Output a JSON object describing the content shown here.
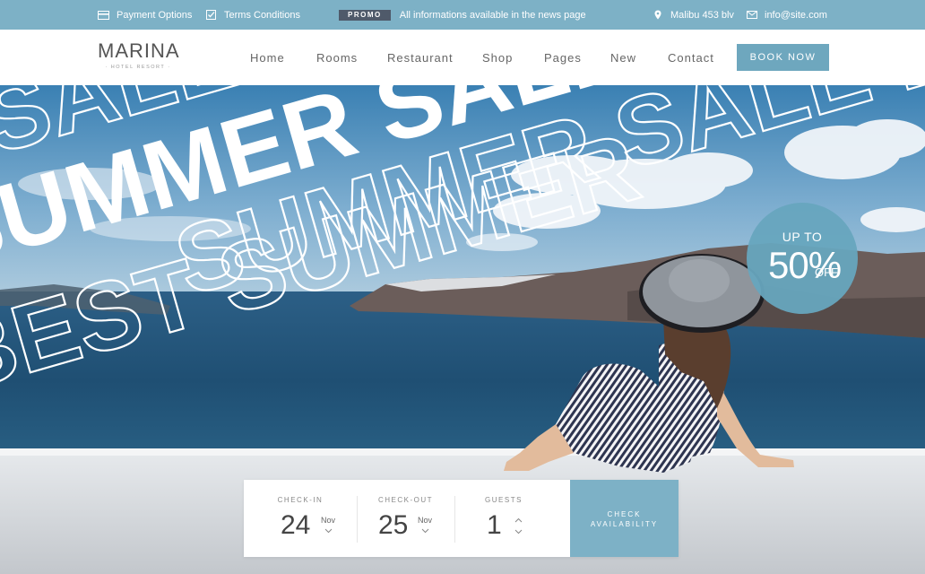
{
  "topbar": {
    "payment_label": "Payment Options",
    "terms_label": "Terms Conditions",
    "promo_badge": "PROMO",
    "promo_text": "All informations available in the news page",
    "address": "Malibu 453 blv",
    "email": "info@site.com"
  },
  "brand": {
    "name": "MARINA",
    "tagline": "· HOTEL RESORT ·"
  },
  "nav": {
    "items": [
      "Home",
      "Rooms",
      "Restaurant",
      "Shop",
      "Pages",
      "New",
      "Contact"
    ],
    "cta": "BOOK NOW"
  },
  "hero": {
    "headline_outline_1": "SALE BE",
    "headline_solid": "SUMMER SALE B",
    "headline_outline_2": "SUMMER SALE BE",
    "headline_outline_3": "BEST SUMMER",
    "badge": {
      "upto": "UP TO",
      "percent": "50%",
      "off": "OFF"
    }
  },
  "booking": {
    "checkin": {
      "label": "CHECK-IN",
      "day": "24",
      "month": "Nov"
    },
    "checkout": {
      "label": "CHECK-OUT",
      "day": "25",
      "month": "Nov"
    },
    "guests": {
      "label": "GUESTS",
      "count": "1"
    },
    "button_line1": "CHECK",
    "button_line2": "AVAILABILITY"
  },
  "colors": {
    "accent": "#7db1c6",
    "promo_bg": "#4f5a6a",
    "sea": "#1f4f73"
  },
  "icons": [
    "card-icon",
    "checkbox-icon",
    "location-pin-icon",
    "mail-icon",
    "chevron-down-icon",
    "chevron-up-icon"
  ]
}
